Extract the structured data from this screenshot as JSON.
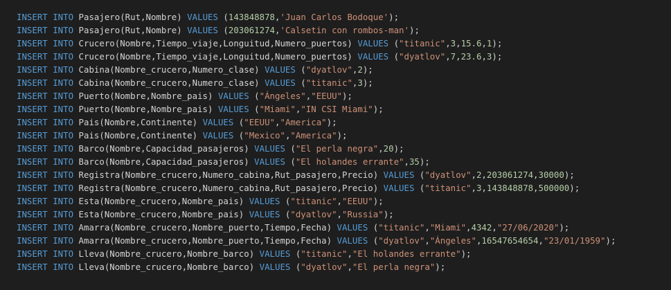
{
  "colors": {
    "background": "#1e1e1e",
    "keyword": "#569cd6",
    "text": "#d4d4d4",
    "string": "#ce9178",
    "number": "#b5cea8"
  },
  "lines": [
    [
      [
        "kw",
        "INSERT INTO"
      ],
      [
        "txt",
        " Pasajero(Rut,Nombre) "
      ],
      [
        "kw",
        "VALUES"
      ],
      [
        "txt",
        " ("
      ],
      [
        "num",
        "143848878"
      ],
      [
        "txt",
        ","
      ],
      [
        "str",
        "'Juan Carlos Bodoque'"
      ],
      [
        "txt",
        ");"
      ]
    ],
    [
      [
        "kw",
        "INSERT INTO"
      ],
      [
        "txt",
        " Pasajero(Rut,Nombre) "
      ],
      [
        "kw",
        "VALUES"
      ],
      [
        "txt",
        " ("
      ],
      [
        "num",
        "203061274"
      ],
      [
        "txt",
        ","
      ],
      [
        "str",
        "'Calsetin con rombos-man'"
      ],
      [
        "txt",
        ");"
      ]
    ],
    [
      [
        "kw",
        "INSERT INTO"
      ],
      [
        "txt",
        " Crucero(Nombre,Tiempo_viaje,Longuitud,Numero_puertos) "
      ],
      [
        "kw",
        "VALUES"
      ],
      [
        "txt",
        " ("
      ],
      [
        "str",
        "\"titanic\""
      ],
      [
        "txt",
        ","
      ],
      [
        "num",
        "3"
      ],
      [
        "txt",
        ","
      ],
      [
        "num",
        "15.6"
      ],
      [
        "txt",
        ","
      ],
      [
        "num",
        "1"
      ],
      [
        "txt",
        ");"
      ]
    ],
    [
      [
        "kw",
        "INSERT INTO"
      ],
      [
        "txt",
        " Crucero(Nombre,Tiempo_viaje,Longuitud,Numero_puertos) "
      ],
      [
        "kw",
        "VALUES"
      ],
      [
        "txt",
        " ("
      ],
      [
        "str",
        "\"dyatlov\""
      ],
      [
        "txt",
        ","
      ],
      [
        "num",
        "7"
      ],
      [
        "txt",
        ","
      ],
      [
        "num",
        "23.6"
      ],
      [
        "txt",
        ","
      ],
      [
        "num",
        "3"
      ],
      [
        "txt",
        ");"
      ]
    ],
    [
      [
        "kw",
        "INSERT INTO"
      ],
      [
        "txt",
        " Cabina(Nombre_crucero,Numero_clase) "
      ],
      [
        "kw",
        "VALUES"
      ],
      [
        "txt",
        " ("
      ],
      [
        "str",
        "\"dyatlov\""
      ],
      [
        "txt",
        ","
      ],
      [
        "num",
        "2"
      ],
      [
        "txt",
        ");"
      ]
    ],
    [
      [
        "kw",
        "INSERT INTO"
      ],
      [
        "txt",
        " Cabina(Nombre_crucero,Numero_clase) "
      ],
      [
        "kw",
        "VALUES"
      ],
      [
        "txt",
        " ("
      ],
      [
        "str",
        "\"titanic\""
      ],
      [
        "txt",
        ","
      ],
      [
        "num",
        "3"
      ],
      [
        "txt",
        ");"
      ]
    ],
    [
      [
        "kw",
        "INSERT INTO"
      ],
      [
        "txt",
        " Puerto(Nombre,Nombre_pais) "
      ],
      [
        "kw",
        "VALUES"
      ],
      [
        "txt",
        " ("
      ],
      [
        "str",
        "\"Ángeles\""
      ],
      [
        "txt",
        ","
      ],
      [
        "str",
        "\"EEUU\""
      ],
      [
        "txt",
        ");"
      ]
    ],
    [
      [
        "kw",
        "INSERT INTO"
      ],
      [
        "txt",
        " Puerto(Nombre,Nombre_pais) "
      ],
      [
        "kw",
        "VALUES"
      ],
      [
        "txt",
        " ("
      ],
      [
        "str",
        "\"Miami\""
      ],
      [
        "txt",
        ","
      ],
      [
        "str",
        "\"IN CSI Miami\""
      ],
      [
        "txt",
        ");"
      ]
    ],
    [
      [
        "kw",
        "INSERT INTO"
      ],
      [
        "txt",
        " Pais(Nombre,Continente) "
      ],
      [
        "kw",
        "VALUES"
      ],
      [
        "txt",
        " ("
      ],
      [
        "str",
        "\"EEUU\""
      ],
      [
        "txt",
        ","
      ],
      [
        "str",
        "\"America\""
      ],
      [
        "txt",
        ");"
      ]
    ],
    [
      [
        "kw",
        "INSERT INTO"
      ],
      [
        "txt",
        " Pais(Nombre,Continente) "
      ],
      [
        "kw",
        "VALUES"
      ],
      [
        "txt",
        " ("
      ],
      [
        "str",
        "\"Mexico\""
      ],
      [
        "txt",
        ","
      ],
      [
        "str",
        "\"America\""
      ],
      [
        "txt",
        ");"
      ]
    ],
    [
      [
        "kw",
        "INSERT INTO"
      ],
      [
        "txt",
        " Barco(Nombre,Capacidad_pasajeros) "
      ],
      [
        "kw",
        "VALUES"
      ],
      [
        "txt",
        " ("
      ],
      [
        "str",
        "\"El perla negra\""
      ],
      [
        "txt",
        ","
      ],
      [
        "num",
        "20"
      ],
      [
        "txt",
        ");"
      ]
    ],
    [
      [
        "kw",
        "INSERT INTO"
      ],
      [
        "txt",
        " Barco(Nombre,Capacidad_pasajeros) "
      ],
      [
        "kw",
        "VALUES"
      ],
      [
        "txt",
        " ("
      ],
      [
        "str",
        "\"El holandes errante\""
      ],
      [
        "txt",
        ","
      ],
      [
        "num",
        "35"
      ],
      [
        "txt",
        ");"
      ]
    ],
    [
      [
        "kw",
        "INSERT INTO"
      ],
      [
        "txt",
        " Registra(Nombre_crucero,Numero_cabina,Rut_pasajero,Precio) "
      ],
      [
        "kw",
        "VALUES"
      ],
      [
        "txt",
        " ("
      ],
      [
        "str",
        "\"dyatlov\""
      ],
      [
        "txt",
        ","
      ],
      [
        "num",
        "2"
      ],
      [
        "txt",
        ","
      ],
      [
        "num",
        "203061274"
      ],
      [
        "txt",
        ","
      ],
      [
        "num",
        "30000"
      ],
      [
        "txt",
        ");"
      ]
    ],
    [
      [
        "kw",
        "INSERT INTO"
      ],
      [
        "txt",
        " Registra(Nombre_crucero,Numero_cabina,Rut_pasajero,Precio) "
      ],
      [
        "kw",
        "VALUES"
      ],
      [
        "txt",
        " ("
      ],
      [
        "str",
        "\"titanic\""
      ],
      [
        "txt",
        ","
      ],
      [
        "num",
        "3"
      ],
      [
        "txt",
        ","
      ],
      [
        "num",
        "143848878"
      ],
      [
        "txt",
        ","
      ],
      [
        "num",
        "500000"
      ],
      [
        "txt",
        ");"
      ]
    ],
    [
      [
        "kw",
        "INSERT INTO"
      ],
      [
        "txt",
        " Esta(Nombre_crucero,Nombre_pais) "
      ],
      [
        "kw",
        "VALUES"
      ],
      [
        "txt",
        " ("
      ],
      [
        "str",
        "\"titanic\""
      ],
      [
        "txt",
        ","
      ],
      [
        "str",
        "\"EEUU\""
      ],
      [
        "txt",
        ");"
      ]
    ],
    [
      [
        "kw",
        "INSERT INTO"
      ],
      [
        "txt",
        " Esta(Nombre_crucero,Nombre_pais) "
      ],
      [
        "kw",
        "VALUES"
      ],
      [
        "txt",
        " ("
      ],
      [
        "str",
        "\"dyatlov\""
      ],
      [
        "txt",
        ","
      ],
      [
        "str",
        "\"Russia\""
      ],
      [
        "txt",
        ");"
      ]
    ],
    [
      [
        "kw",
        "INSERT INTO"
      ],
      [
        "txt",
        " Amarra(Nombre_crucero,Nombre_puerto,Tiempo,Fecha) "
      ],
      [
        "kw",
        "VALUES"
      ],
      [
        "txt",
        " ("
      ],
      [
        "str",
        "\"titanic\""
      ],
      [
        "txt",
        ","
      ],
      [
        "str",
        "\"Miami\""
      ],
      [
        "txt",
        ","
      ],
      [
        "num",
        "4342"
      ],
      [
        "txt",
        ","
      ],
      [
        "str",
        "\"27/06/2020\""
      ],
      [
        "txt",
        ");"
      ]
    ],
    [
      [
        "kw",
        "INSERT INTO"
      ],
      [
        "txt",
        " Amarra(Nombre_crucero,Nombre_puerto,Tiempo,Fecha) "
      ],
      [
        "kw",
        "VALUES"
      ],
      [
        "txt",
        " ("
      ],
      [
        "str",
        "\"dyatlov\""
      ],
      [
        "txt",
        ","
      ],
      [
        "str",
        "\"Ángeles\""
      ],
      [
        "txt",
        ","
      ],
      [
        "num",
        "16547654654"
      ],
      [
        "txt",
        ","
      ],
      [
        "str",
        "\"23/01/1959\""
      ],
      [
        "txt",
        ");"
      ]
    ],
    [
      [
        "kw",
        "INSERT INTO"
      ],
      [
        "txt",
        " Lleva(Nombre_crucero,Nombre_barco) "
      ],
      [
        "kw",
        "VALUES"
      ],
      [
        "txt",
        " ("
      ],
      [
        "str",
        "\"titanic\""
      ],
      [
        "txt",
        ","
      ],
      [
        "str",
        "\"El holandes errante\""
      ],
      [
        "txt",
        ");"
      ]
    ],
    [
      [
        "kw",
        "INSERT INTO"
      ],
      [
        "txt",
        " Lleva(Nombre_crucero,Nombre_barco) "
      ],
      [
        "kw",
        "VALUES"
      ],
      [
        "txt",
        " ("
      ],
      [
        "str",
        "\"dyatlov\""
      ],
      [
        "txt",
        ","
      ],
      [
        "str",
        "\"El perla negra\""
      ],
      [
        "txt",
        ");"
      ]
    ]
  ]
}
